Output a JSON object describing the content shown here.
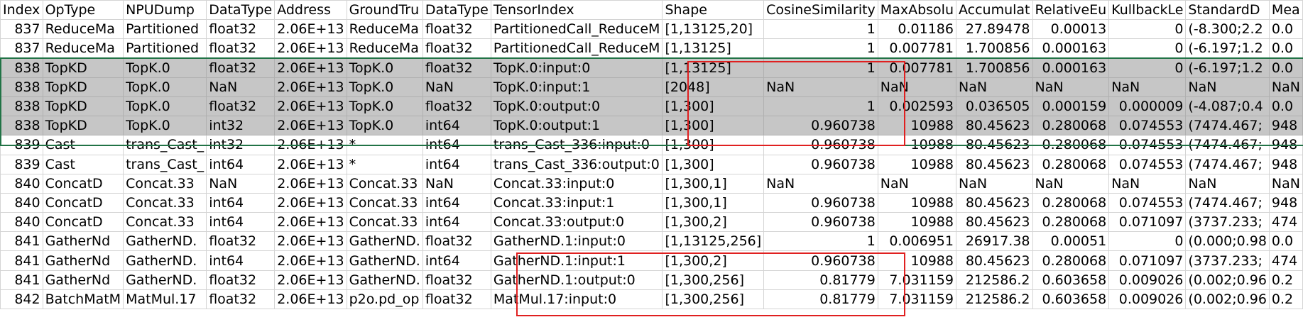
{
  "headers": [
    "Index",
    "OpType",
    "NPUDump",
    "DataType",
    "Address",
    "GroundTru",
    "DataType",
    "TensorIndex",
    "Shape",
    "CosineSimilarity",
    "MaxAbsolu",
    "Accumulat",
    "RelativeEu",
    "KullbackLe",
    "StandardD",
    "Mea"
  ],
  "rows": [
    [
      "837",
      "ReduceMa",
      "Partitioned",
      "float32",
      "2.06E+13",
      "ReduceMa",
      "float32",
      "PartitionedCall_ReduceM",
      "[1,13125,20]",
      "1",
      "0.01186",
      "27.89478",
      "0.00013",
      "0",
      "(-8.300;2.2",
      "0.0"
    ],
    [
      "837",
      "ReduceMa",
      "Partitioned",
      "float32",
      "2.06E+13",
      "ReduceMa",
      "float32",
      "PartitionedCall_ReduceM",
      "[1,13125]",
      "1",
      "0.007781",
      "1.700856",
      "0.000163",
      "0",
      "(-6.197;1.2",
      "0.0"
    ],
    [
      "838",
      "TopKD",
      "TopK.0",
      "float32",
      "2.06E+13",
      "TopK.0",
      "float32",
      "TopK.0:input:0",
      "[1,13125]",
      "1",
      "0.007781",
      "1.700856",
      "0.000163",
      "0",
      "(-6.197;1.2",
      "0.0"
    ],
    [
      "838",
      "TopKD",
      "TopK.0",
      "NaN",
      "2.06E+13",
      "TopK.0",
      "NaN",
      "TopK.0:input:1",
      "[2048]",
      "NaN",
      "NaN",
      "NaN",
      "NaN",
      "NaN",
      "NaN",
      "NaN"
    ],
    [
      "838",
      "TopKD",
      "TopK.0",
      "float32",
      "2.06E+13",
      "TopK.0",
      "float32",
      "TopK.0:output:0",
      "[1,300]",
      "1",
      "0.002593",
      "0.036505",
      "0.000159",
      "0.000009",
      "(-4.087;0.4",
      "0.0"
    ],
    [
      "838",
      "TopKD",
      "TopK.0",
      "int32",
      "2.06E+13",
      "TopK.0",
      "int64",
      "TopK.0:output:1",
      "[1,300]",
      "0.960738",
      "10988",
      "80.45623",
      "0.280068",
      "0.074553",
      "(7474.467;",
      "948"
    ],
    [
      "839",
      "Cast",
      "trans_Cast_",
      "int32",
      "2.06E+13",
      "*",
      "int64",
      "trans_Cast_336:input:0",
      "[1,300]",
      "0.960738",
      "10988",
      "80.45623",
      "0.280068",
      "0.074553",
      "(7474.467;",
      "948"
    ],
    [
      "839",
      "Cast",
      "trans_Cast_",
      "int64",
      "2.06E+13",
      "*",
      "int64",
      "trans_Cast_336:output:0",
      "[1,300]",
      "0.960738",
      "10988",
      "80.45623",
      "0.280068",
      "0.074553",
      "(7474.467;",
      "948"
    ],
    [
      "840",
      "ConcatD",
      "Concat.33",
      "NaN",
      "2.06E+13",
      "Concat.33",
      "NaN",
      "Concat.33:input:0",
      "[1,300,1]",
      "NaN",
      "NaN",
      "NaN",
      "NaN",
      "NaN",
      "NaN",
      "NaN"
    ],
    [
      "840",
      "ConcatD",
      "Concat.33",
      "int64",
      "2.06E+13",
      "Concat.33",
      "int64",
      "Concat.33:input:1",
      "[1,300,1]",
      "0.960738",
      "10988",
      "80.45623",
      "0.280068",
      "0.074553",
      "(7474.467;",
      "948"
    ],
    [
      "840",
      "ConcatD",
      "Concat.33",
      "int64",
      "2.06E+13",
      "Concat.33",
      "int64",
      "Concat.33:output:0",
      "[1,300,2]",
      "0.960738",
      "10988",
      "80.45623",
      "0.280068",
      "0.071097",
      "(3737.233;",
      "474"
    ],
    [
      "841",
      "GatherNd",
      "GatherND.",
      "float32",
      "2.06E+13",
      "GatherND.",
      "float32",
      "GatherND.1:input:0",
      "[1,13125,256]",
      "1",
      "0.006951",
      "26917.38",
      "0.00051",
      "0",
      "(0.000;0.98",
      "0.0"
    ],
    [
      "841",
      "GatherNd",
      "GatherND.",
      "int64",
      "2.06E+13",
      "GatherND.",
      "int64",
      "GatherND.1:input:1",
      "[1,300,2]",
      "0.960738",
      "10988",
      "80.45623",
      "0.280068",
      "0.071097",
      "(3737.233;",
      "474"
    ],
    [
      "841",
      "GatherNd",
      "GatherND.",
      "float32",
      "2.06E+13",
      "GatherND.",
      "float32",
      "GatherND.1:output:0",
      "[1,300,256]",
      "0.81779",
      "7.031159",
      "212586.2",
      "0.603658",
      "0.009026",
      "(0.002;0.96",
      "0.2"
    ],
    [
      "842",
      "BatchMatM",
      "MatMul.17",
      "float32",
      "2.06E+13",
      "p2o.pd_op",
      "float32",
      "MatMul.17:input:0",
      "[1,300,256]",
      "0.81779",
      "7.031159",
      "212586.2",
      "0.603658",
      "0.009026",
      "(0.002;0.96",
      "0.2"
    ]
  ],
  "selected_rows": [
    2,
    3,
    4,
    5
  ]
}
